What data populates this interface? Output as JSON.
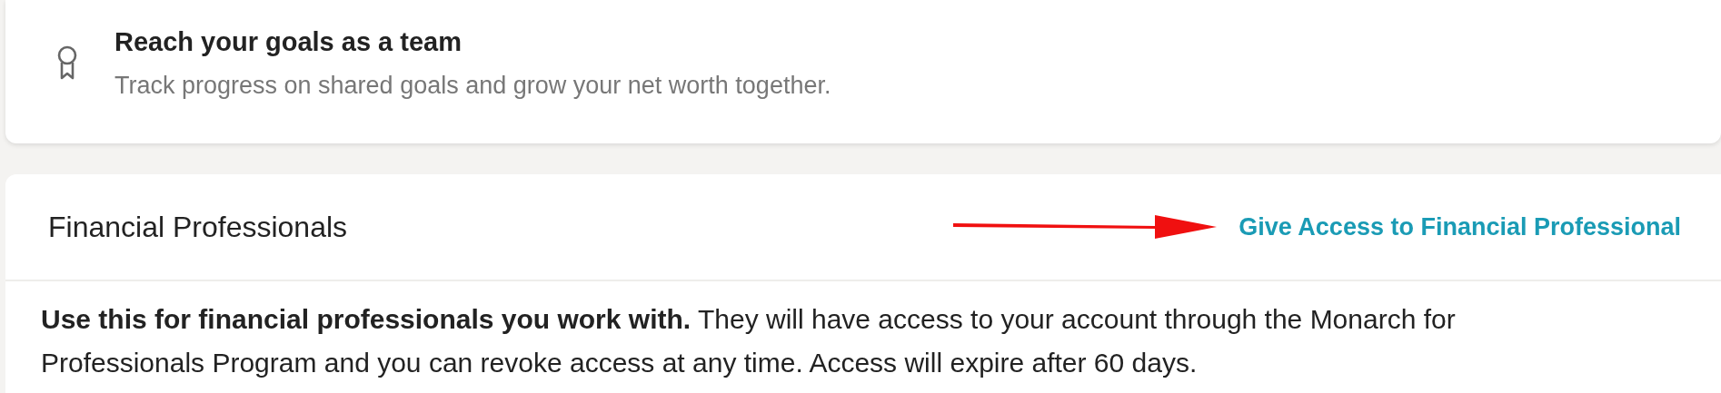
{
  "goal_card": {
    "title": "Reach your goals as a team",
    "description": "Track progress on shared goals and grow your net worth together."
  },
  "professionals_card": {
    "title": "Financial Professionals",
    "link": "Give Access to Financial Professional",
    "annotation_arrow": true,
    "description": "**Use this for financial professionals you work with.** They will have access to your account through the Monarch for Professionals Program and you can revoke access at any time. Access will expire after 60 days."
  }
}
